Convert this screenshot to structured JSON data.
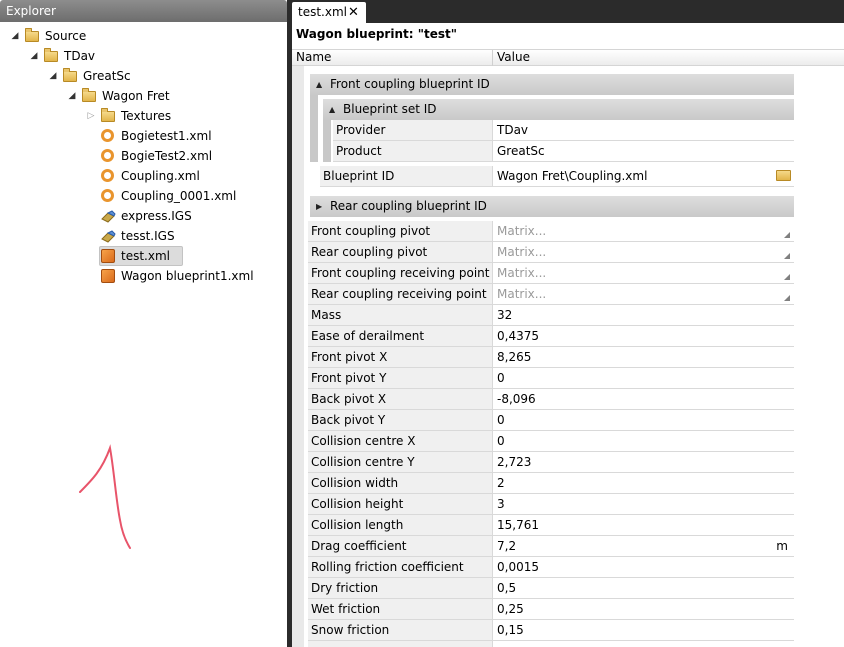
{
  "explorer": {
    "title": "Explorer",
    "tree": [
      {
        "label": "Source",
        "icon": "folder-icon",
        "level": 0,
        "expander": "expanded"
      },
      {
        "label": "TDav",
        "icon": "folder-icon",
        "level": 1,
        "expander": "expanded"
      },
      {
        "label": "GreatSc",
        "icon": "folder-icon",
        "level": 2,
        "expander": "expanded"
      },
      {
        "label": "Wagon Fret",
        "icon": "folder-icon",
        "level": 3,
        "expander": "expanded"
      },
      {
        "label": "Textures",
        "icon": "folder-icon",
        "level": 4,
        "expander": "collapsed"
      },
      {
        "label": "Bogietest1.xml",
        "icon": "ring-file-icon",
        "level": 4,
        "expander": "none"
      },
      {
        "label": "BogieTest2.xml",
        "icon": "ring-file-icon",
        "level": 4,
        "expander": "none"
      },
      {
        "label": "Coupling.xml",
        "icon": "ring-file-icon",
        "level": 4,
        "expander": "none"
      },
      {
        "label": "Coupling_0001.xml",
        "icon": "ring-file-icon",
        "level": 4,
        "expander": "none"
      },
      {
        "label": "express.IGS",
        "icon": "igs-file-icon",
        "level": 4,
        "expander": "none"
      },
      {
        "label": "tesst.IGS",
        "icon": "igs-file-icon",
        "level": 4,
        "expander": "none"
      },
      {
        "label": "test.xml",
        "icon": "wagon-file-icon",
        "level": 4,
        "expander": "none",
        "selected": true
      },
      {
        "label": "Wagon blueprint1.xml",
        "icon": "wagon-file-icon",
        "level": 4,
        "expander": "none"
      }
    ]
  },
  "tab": {
    "label": "test.xml",
    "close": "✕"
  },
  "document": {
    "title": "Wagon blueprint: \"test\"",
    "columns": {
      "name": "Name",
      "value": "Value"
    },
    "front_coupling": {
      "label": "Front coupling blueprint ID",
      "blueprint_set": {
        "label": "Blueprint set ID",
        "rows": [
          {
            "name": "Provider",
            "value": "TDav"
          },
          {
            "name": "Product",
            "value": "GreatSc"
          }
        ]
      },
      "blueprint_id": {
        "name": "Blueprint ID",
        "value": "Wagon Fret\\Coupling.xml"
      }
    },
    "rear_coupling": {
      "label": "Rear coupling blueprint ID"
    },
    "rows": [
      {
        "name": "Front coupling pivot",
        "value": "Matrix...",
        "kind": "matrix"
      },
      {
        "name": "Rear coupling pivot",
        "value": "Matrix...",
        "kind": "matrix"
      },
      {
        "name": "Front coupling receiving point",
        "value": "Matrix...",
        "kind": "matrix"
      },
      {
        "name": "Rear coupling receiving point",
        "value": "Matrix...",
        "kind": "matrix"
      },
      {
        "name": "Mass",
        "value": "32"
      },
      {
        "name": "Ease of derailment",
        "value": "0,4375"
      },
      {
        "name": "Front pivot X",
        "value": "8,265"
      },
      {
        "name": "Front pivot Y",
        "value": "0"
      },
      {
        "name": "Back pivot X",
        "value": "-8,096"
      },
      {
        "name": "Back pivot Y",
        "value": "0"
      },
      {
        "name": "Collision centre X",
        "value": "0"
      },
      {
        "name": "Collision centre Y",
        "value": "2,723"
      },
      {
        "name": "Collision width",
        "value": "2"
      },
      {
        "name": "Collision height",
        "value": "3"
      },
      {
        "name": "Collision length",
        "value": "15,761"
      },
      {
        "name": "Drag coefficient",
        "value": "7,2",
        "unit": "m"
      },
      {
        "name": "Rolling friction coefficient",
        "value": "0,0015"
      },
      {
        "name": "Dry friction",
        "value": "0,5"
      },
      {
        "name": "Wet friction",
        "value": "0,25"
      },
      {
        "name": "Snow friction",
        "value": "0,15"
      },
      {
        "name": "",
        "value": ""
      }
    ]
  },
  "colors": {
    "header": "#7a7a7a",
    "group": "#d3d3d3",
    "selection": "#dcdcdc",
    "annotation": "#e8546a"
  }
}
